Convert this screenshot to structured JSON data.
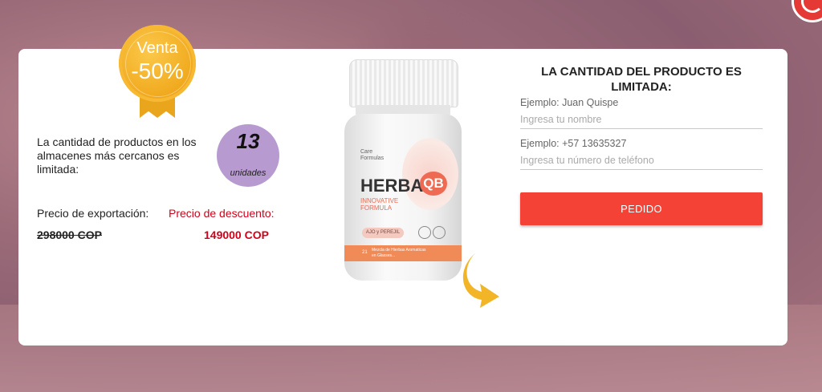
{
  "badge": {
    "line1": "Venta",
    "line2": "-50%"
  },
  "stock": {
    "text": "La cantidad de productos en los almacenes más cercanos es limitada:",
    "count": "13",
    "unit": "unidades"
  },
  "prices": {
    "export_label": "Precio de exportación:",
    "discount_label": "Precio de descuento:",
    "old_price": "298000 COP",
    "new_price": "149000 COP"
  },
  "product": {
    "brand_small": "Care Formulas",
    "name_main": "HERBA",
    "name_badge": "QB",
    "tagline": "INNOVATIVE FORMULA",
    "pill_text": "AJO y PEREJIL",
    "band_count": "21",
    "band_text": "Mezcla de Hierbas Aromaticas en Glasses..."
  },
  "form": {
    "title": "LA CANTIDAD DEL PRODUCTO ES LIMITADA:",
    "name_label": "Ejemplo: Juan Quispe",
    "name_placeholder": "Ingresa tu nombre",
    "phone_label": "Ejemplo: +57 13635327",
    "phone_placeholder": "Ingresa tu número de teléfono",
    "submit_label": "PEDIDO"
  },
  "colors": {
    "accent": "#f44336",
    "discount": "#d0021b",
    "badge": "#f0a81c",
    "units_circle": "#b79ad0"
  }
}
